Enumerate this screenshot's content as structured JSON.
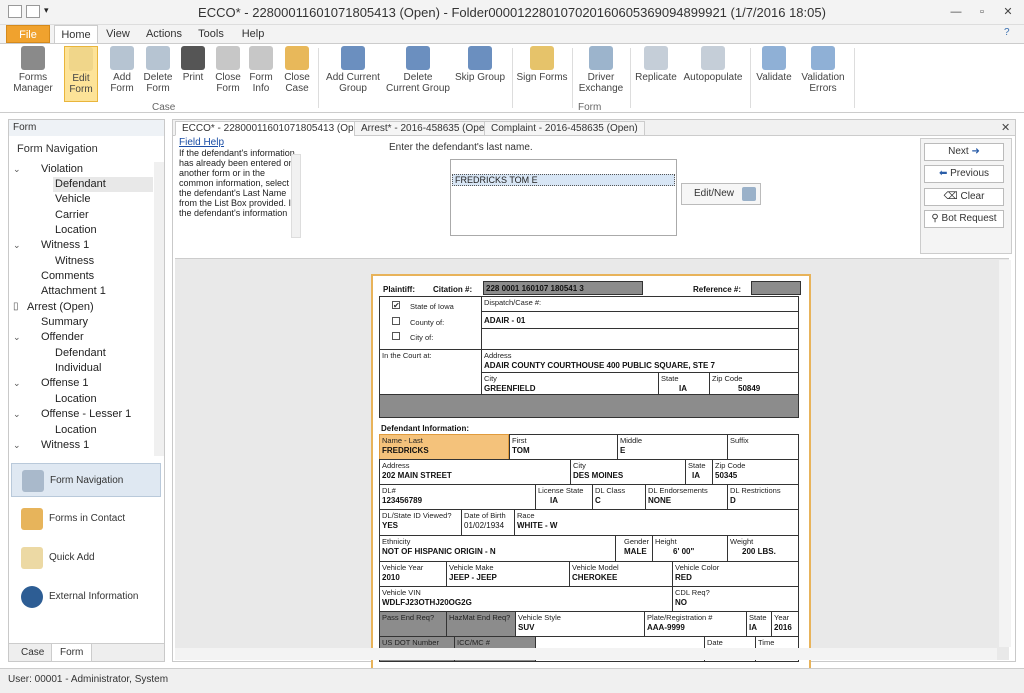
{
  "window": {
    "title": "ECCO* - 2280001160107180541​3 (Open) - Folder00001228010702016060536909489​9921 (1/7/2016 18:05)"
  },
  "menu": {
    "file": "File",
    "home": "Home",
    "view": "View",
    "actions": "Actions",
    "tools": "Tools",
    "help": "Help"
  },
  "ribbon": {
    "forms_manager": "Forms\nManager",
    "edit_form": "Edit\nForm",
    "add_form": "Add\nForm",
    "delete_form": "Delete\nForm",
    "print": "Print",
    "close_form": "Close\nForm",
    "form_info": "Form\nInfo",
    "close_case": "Close\nCase",
    "add_current_group": "Add Current\nGroup",
    "delete_current_group": "Delete\nCurrent Group",
    "skip_group": "Skip Group",
    "sign_forms": "Sign Forms",
    "driver_exchange": "Driver\nExchange",
    "replicate": "Replicate",
    "autopopulate": "Autopopulate",
    "validate": "Validate",
    "validation_errors": "Validation\nErrors",
    "group_case": "Case",
    "group_form": "Form"
  },
  "left": {
    "header": "Form",
    "nav_title": "Form Navigation",
    "tree": [
      "Violation",
      "Defendant",
      "Vehicle",
      "Carrier",
      "Location",
      "Witness 1",
      "Witness",
      "Comments",
      "Attachment 1",
      "Arrest (Open)",
      "Summary",
      "Offender",
      "Defendant",
      "Individual",
      "Offense 1",
      "Location",
      "Offense - Lesser 1",
      "Location",
      "Witness 1"
    ],
    "panes": {
      "form_navigation": "Form Navigation",
      "forms_in_contact": "Forms in Contact",
      "quick_add": "Quick Add",
      "external_information": "External Information"
    },
    "tabs": {
      "case": "Case",
      "form": "Form"
    }
  },
  "doc": {
    "tabs": [
      "ECCO* - 2280001160107180541​3 (Open)",
      "Arrest* - 2016-458635 (Open)",
      "Complaint - 2016-458635 (Open)"
    ],
    "help_title": "Field Help",
    "help_text": "If the defendant's information has already been entered on another form or in the common information, select the defendant's Last Name from the List Box provided. If the defendant's information",
    "prompt": "Enter the defendant's last name.",
    "list_item": "FREDRICKS  TOM  E",
    "edit_new": "Edit/New",
    "actions": {
      "next": "Next",
      "previous": "Previous",
      "clear": "Clear",
      "bot_request": "Bot Request"
    }
  },
  "form": {
    "plaintiff": "Plaintiff:",
    "citation_label": "Citation #:",
    "citation": "228 0001 160107 180541 3",
    "reference_label": "Reference #:",
    "state_of_iowa": "State of Iowa",
    "county_of": "County of:",
    "city_of": "City of:",
    "dispatch_label": "Dispatch/Case #:",
    "court_county": "ADAIR - 01",
    "in_court_at": "In the Court at:",
    "address_label": "Address",
    "court_address": "ADAIR COUNTY COURTHOUSE  400 PUBLIC SQUARE, STE 7",
    "city_label": "City",
    "court_city": "GREENFIELD",
    "state_label": "State",
    "court_state": "IA",
    "zip_label": "Zip Code",
    "court_zip": "50849",
    "defendant_info": "Defendant Information:",
    "name_last_label": "Name - Last",
    "name_last": "FREDRICKS",
    "first_label": "First",
    "first": "TOM",
    "middle_label": "Middle",
    "middle": "E",
    "suffix_label": "Suffix",
    "def_address": "202 MAIN STREET",
    "def_city": "DES MOINES",
    "def_state": "IA",
    "def_zip": "50345",
    "dl_label": "DL#",
    "dl": "123456789",
    "lic_state_label": "License State",
    "lic_state": "IA",
    "dl_class_label": "DL Class",
    "dl_class": "C",
    "dl_endorse_label": "DL Endorsements",
    "dl_endorse": "NONE",
    "dl_restrict_label": "DL Restrictions",
    "dl_restrict": "D",
    "dl_viewed_label": "DL/State ID Viewed?",
    "dl_viewed": "YES",
    "dob_label": "Date of Birth",
    "dob": "01/02/1934",
    "race_label": "Race",
    "race": "WHITE - W",
    "ethnicity_label": "Ethnicity",
    "ethnicity": "NOT OF HISPANIC ORIGIN - N",
    "gender_label": "Gender",
    "gender": "MALE",
    "height_label": "Height",
    "height": "6' 00\"",
    "weight_label": "Weight",
    "weight": "200 LBS.",
    "veh_year_label": "Vehicle Year",
    "veh_year": "2010",
    "veh_make_label": "Vehicle Make",
    "veh_make": "JEEP - JEEP",
    "veh_model_label": "Vehicle Model",
    "veh_model": "CHEROKEE",
    "veh_color_label": "Vehicle Color",
    "veh_color": "RED",
    "vin_label": "Vehicle VIN",
    "vin": "WDLFJ23OTHJ20OG2G",
    "cdl_label": "CDL Req?",
    "cdl": "NO",
    "pass_end_label": "Pass End Req?",
    "hazmat_label": "HazMat End Req?",
    "veh_style_label": "Vehicle Style",
    "veh_style": "SUV",
    "plate_label": "Plate/Registration #",
    "plate": "AAA-9999",
    "plate_state": "IA",
    "plate_year": "2016",
    "year_label": "Year",
    "usdot_label": "US DOT Number",
    "icc_label": "ICC/MC #",
    "date_label": "Date",
    "time_label": "Time"
  },
  "status": {
    "text": "User: 00001 - Administrator, System"
  }
}
